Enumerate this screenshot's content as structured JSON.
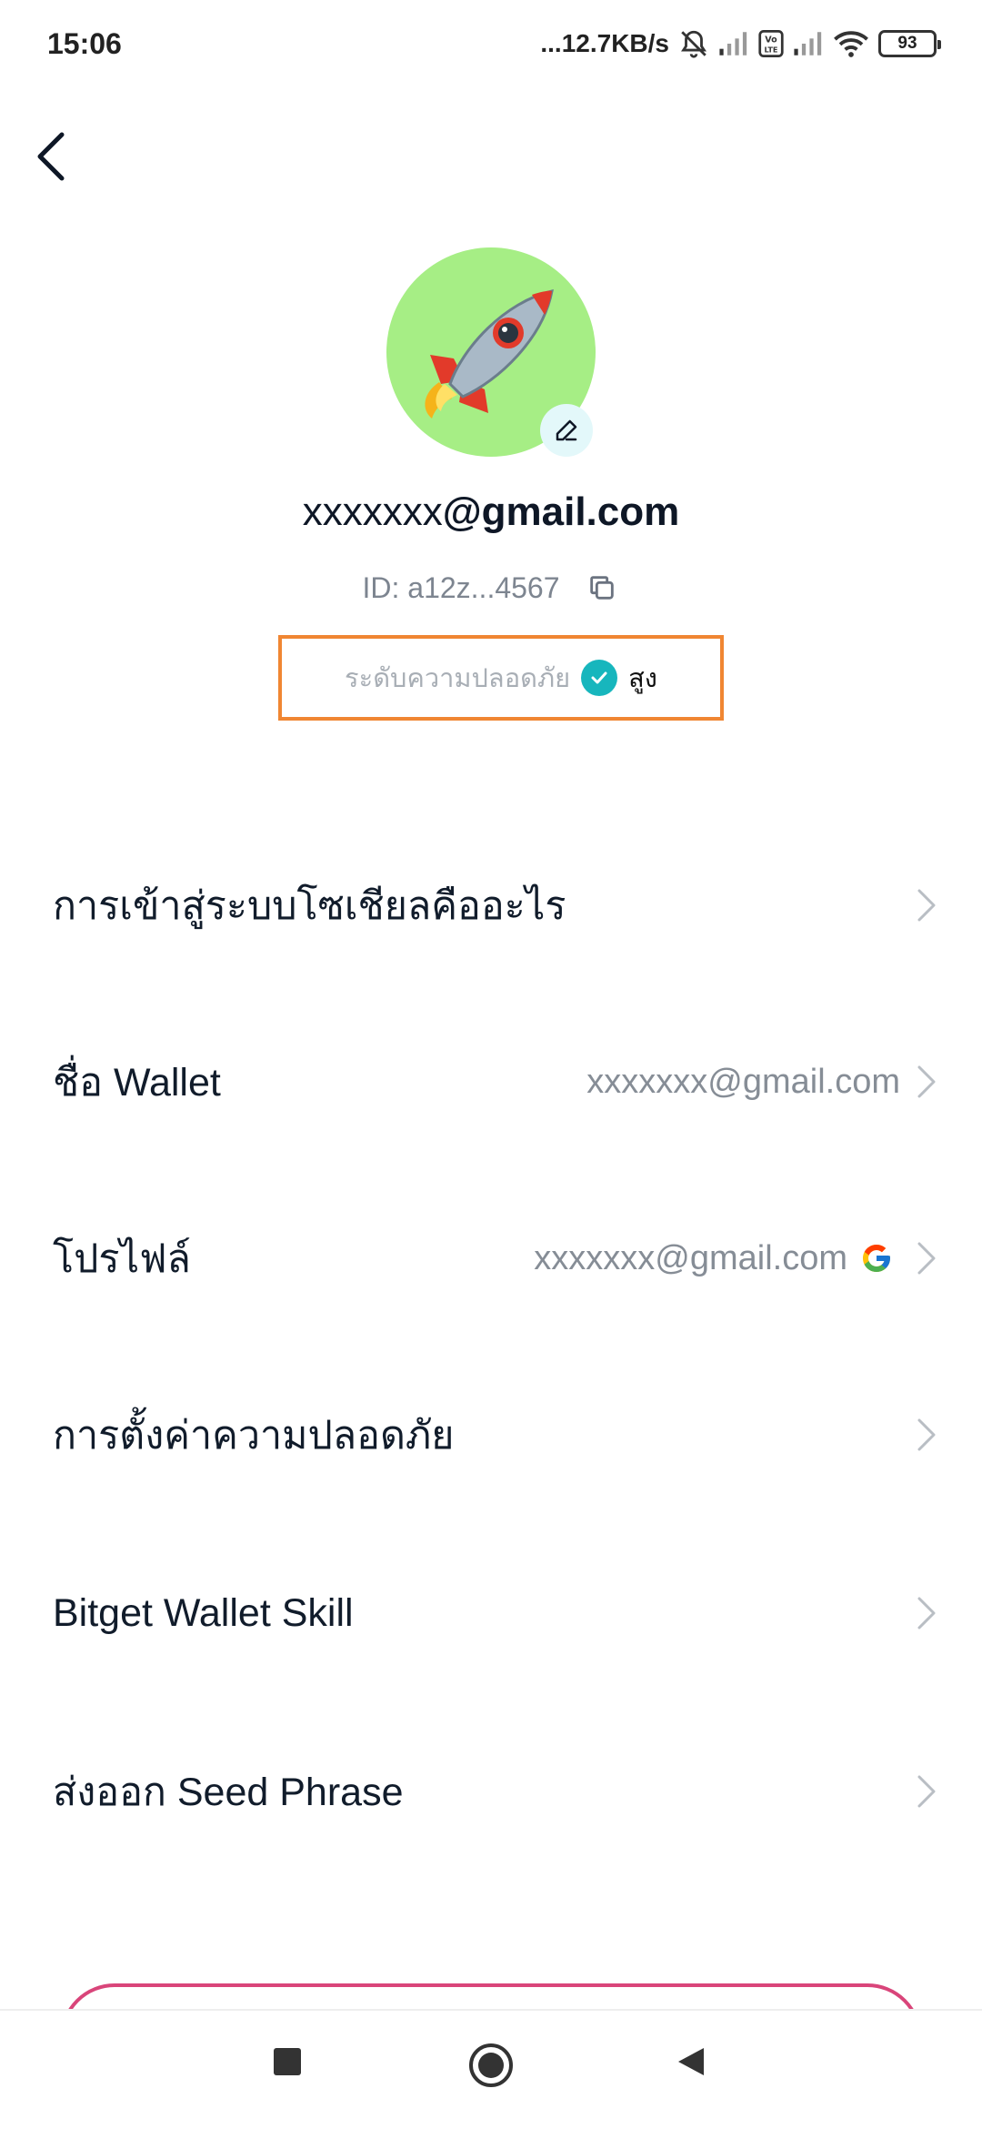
{
  "status_bar": {
    "time": "15:06",
    "network_speed": "...12.7KB/s",
    "battery": "93",
    "icons": [
      "mute-bell-icon",
      "signal-icon",
      "volte-icon",
      "signal-icon",
      "wifi-icon",
      "battery-icon"
    ]
  },
  "header": {
    "back_icon": "chevron-left-icon"
  },
  "profile": {
    "avatar_icon": "rocket-icon",
    "avatar_color": "#a6ee85",
    "edit_icon": "pencil-icon",
    "email_local": "xxxxxxx",
    "email_domain": "@gmail.com",
    "id_label": "ID:",
    "id_value": "a12z...4567",
    "copy_icon": "copy-icon",
    "security_label": "ระดับความปลอดภัย",
    "security_value": "สูง",
    "security_color": "#17b6bd",
    "highlight_color": "#f08632"
  },
  "menu": {
    "items": [
      {
        "label": "การเข้าสู่ระบบโซเชียลคืออะไร",
        "value": ""
      },
      {
        "label": "ชื่อ Wallet",
        "value": "xxxxxxx@gmail.com"
      },
      {
        "label": "โปรไฟล์",
        "value": "xxxxxxx@gmail.com",
        "icon": "google-icon"
      },
      {
        "label": "การตั้งค่าความปลอดภัย",
        "value": ""
      },
      {
        "label": "Bitget Wallet Skill",
        "value": ""
      },
      {
        "label": "ส่งออก Seed Phrase",
        "value": ""
      }
    ]
  },
  "nav_bar": {
    "icons": [
      "recents-square-icon",
      "home-circle-icon",
      "back-triangle-icon"
    ]
  }
}
